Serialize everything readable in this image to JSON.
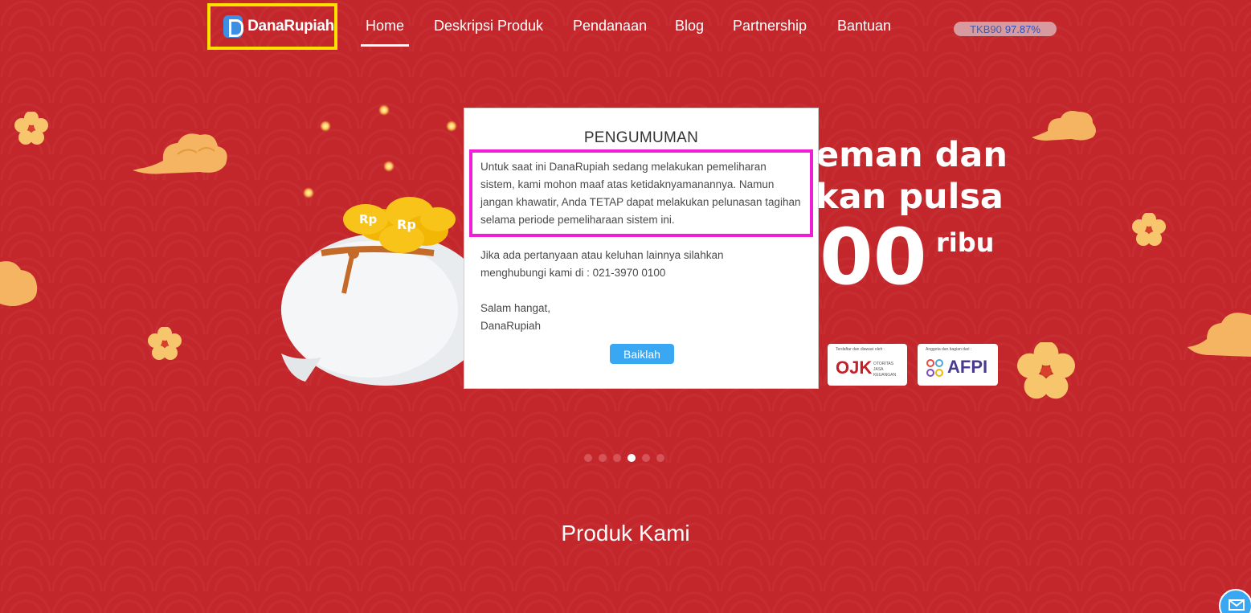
{
  "header": {
    "logo_text": "DanaRupiah",
    "nav": [
      {
        "label": "Home",
        "active": true
      },
      {
        "label": "Deskripsi Produk",
        "active": false
      },
      {
        "label": "Pendanaan",
        "active": false
      },
      {
        "label": "Blog",
        "active": false
      },
      {
        "label": "Partnership",
        "active": false
      },
      {
        "label": "Bantuan",
        "active": false
      }
    ],
    "tkb_label": "TKB90",
    "tkb_value": "97.87%"
  },
  "hero": {
    "line1": "eman dan",
    "line2": "kan pulsa",
    "amount": "00",
    "unit": "ribu",
    "ojk_badge": {
      "caption": "Terdaftar dan diawasi oleh :",
      "name": "OJK",
      "subtitle": "OTORITAS JASA KEUANGAN"
    },
    "afpi_badge": {
      "caption": "Anggota dan bagian dari :",
      "name": "AFPI"
    }
  },
  "modal": {
    "title": "PENGUMUMAN",
    "paragraph1": "Untuk saat ini DanaRupiah sedang melakukan pemeliharan sistem, kami mohon maaf atas ketidaknyamanannya. Namun jangan khawatir, Anda TETAP dapat melakukan pelunasan tagihan selama periode pemeliharaan sistem ini.",
    "paragraph2": "Jika ada pertanyaan atau keluhan lainnya silahkan menghubungi kami di : 021-3970 0100",
    "greeting": "Salam hangat,",
    "signature": "DanaRupiah",
    "button_label": "Baiklah"
  },
  "carousel": {
    "count": 6,
    "active_index": 3
  },
  "section": {
    "title": "Produk Kami"
  },
  "colors": {
    "background": "#c3272b",
    "accent_blue": "#3aa7f2",
    "highlight_yellow": "#ffe100",
    "highlight_magenta": "#f01ed4"
  },
  "icons": {
    "logo": "danarupiah-logo-icon",
    "mail": "envelope-icon"
  }
}
